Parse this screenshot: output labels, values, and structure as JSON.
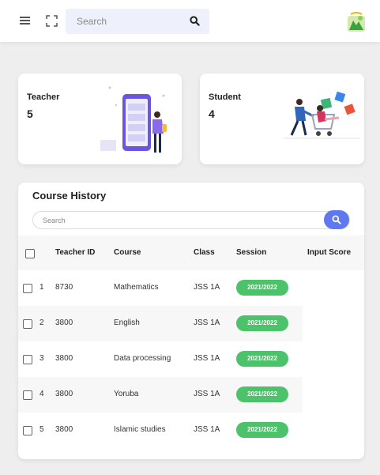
{
  "header": {
    "search_placeholder": "Search"
  },
  "stats": {
    "teacher": {
      "label": "Teacher",
      "value": "5"
    },
    "student": {
      "label": "Student",
      "value": "4"
    }
  },
  "course_history": {
    "title": "Course History",
    "search_placeholder": "Search",
    "columns": [
      "Teacher ID",
      "Course",
      "Class",
      "Session",
      "Input Score"
    ],
    "rows": [
      {
        "no": "1",
        "teacher_id": "8730",
        "course": "Mathematics",
        "class": "JSS 1A",
        "session": "2021/2022"
      },
      {
        "no": "2",
        "teacher_id": "3800",
        "course": "English",
        "class": "JSS 1A",
        "session": "2021/2022"
      },
      {
        "no": "3",
        "teacher_id": "3800",
        "course": "Data processing",
        "class": "JSS 1A",
        "session": "2021/2022"
      },
      {
        "no": "4",
        "teacher_id": "3800",
        "course": "Yoruba",
        "class": "JSS 1A",
        "session": "2021/2022"
      },
      {
        "no": "5",
        "teacher_id": "3800",
        "course": "Islamic studies",
        "class": "JSS 1A",
        "session": "2021/2022"
      }
    ]
  },
  "colors": {
    "accent": "#5f78ee",
    "session_badge": "#4cc36a",
    "search_background": "#eef0fb"
  }
}
